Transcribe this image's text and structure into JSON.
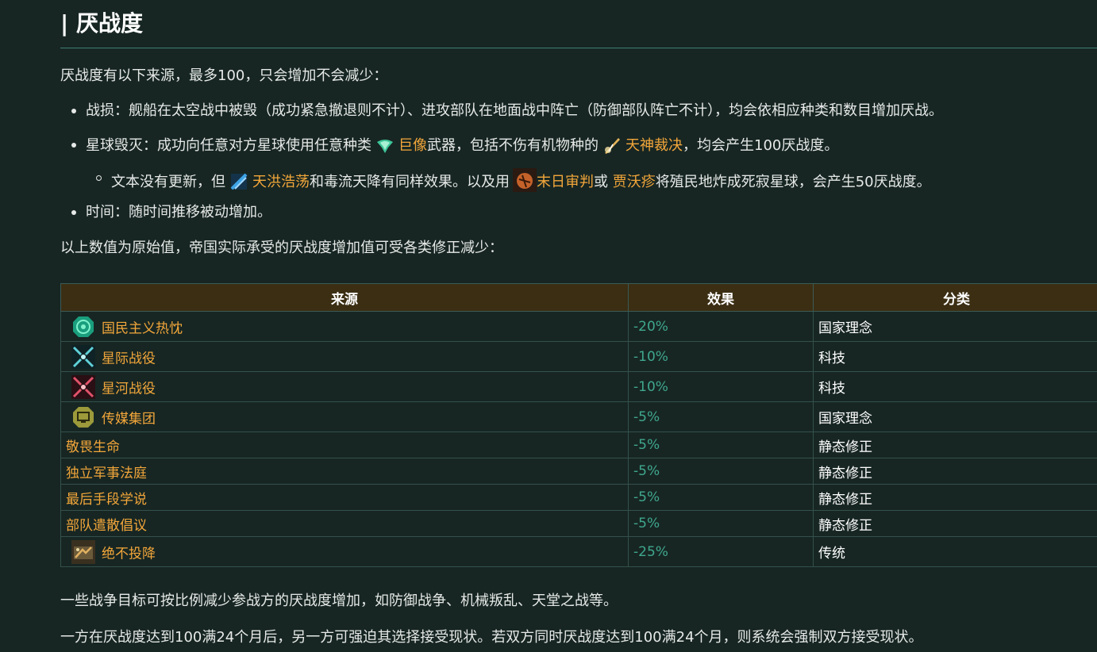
{
  "heading": "| 厌战度",
  "intro": "厌战度有以下来源，最多100，只会增加不会减少：",
  "bullets": {
    "damage": "战损：舰船在太空战中被毁（成功紧急撤退则不计）、进攻部队在地面战中阵亡（防御部队阵亡不计），均会依相应种类和数目增加厌战。",
    "destroy_pre": "星球毁灭：成功向任意对方星球使用任意种类",
    "destroy_link1": "巨像",
    "destroy_mid": "武器，包括不伤有机物种的",
    "destroy_link2": "天神裁决",
    "destroy_post": "，均会产生100厌战度。",
    "sub_pre": "文本没有更新，但",
    "sub_link1": "天洪浩荡",
    "sub_mid1": "和毒流天降有同样效果。以及用",
    "sub_link2": "末日审判",
    "sub_mid2": "或",
    "sub_link3": "贾沃疹",
    "sub_post": "将殖民地炸成死寂星球，会产生50厌战度。",
    "time": "时间：随时间推移被动增加。"
  },
  "modifier_intro": "以上数值为原始值，帝国实际承受的厌战度增加值可受各类修正减少：",
  "table": {
    "headers": [
      "来源",
      "效果",
      "分类"
    ],
    "rows": [
      {
        "source": "国民主义热忱",
        "effect": "-20%",
        "category": "国家理念",
        "icon": "nationalist-zeal-icon"
      },
      {
        "source": "星际战役",
        "effect": "-10%",
        "category": "科技",
        "icon": "interstellar-campaigns-icon"
      },
      {
        "source": "星河战役",
        "effect": "-10%",
        "category": "科技",
        "icon": "galactic-campaigns-icon"
      },
      {
        "source": "传媒集团",
        "effect": "-5%",
        "category": "国家理念",
        "icon": "media-conglomerates-icon"
      },
      {
        "source": "敬畏生命",
        "effect": "-5%",
        "category": "静态修正",
        "icon": ""
      },
      {
        "source": "独立军事法庭",
        "effect": "-5%",
        "category": "静态修正",
        "icon": ""
      },
      {
        "source": "最后手段学说",
        "effect": "-5%",
        "category": "静态修正",
        "icon": ""
      },
      {
        "source": "部队遣散倡议",
        "effect": "-5%",
        "category": "静态修正",
        "icon": ""
      },
      {
        "source": "绝不投降",
        "effect": "-25%",
        "category": "传统",
        "icon": "no-surrender-icon"
      }
    ]
  },
  "footer_1": "一些战争目标可按比例减少参战方的厌战度增加，如防御战争、机械叛乱、天堂之战等。",
  "footer_2": "一方在厌战度达到100满24个月后，另一方可强迫其选择接受现状。若双方同时厌战度达到100满24个月，则系统会强制双方接受现状。",
  "colors": {
    "background": "#172623",
    "link": "#f2a63a",
    "effect": "#3fa78e",
    "table_header": "#3b2e13"
  }
}
